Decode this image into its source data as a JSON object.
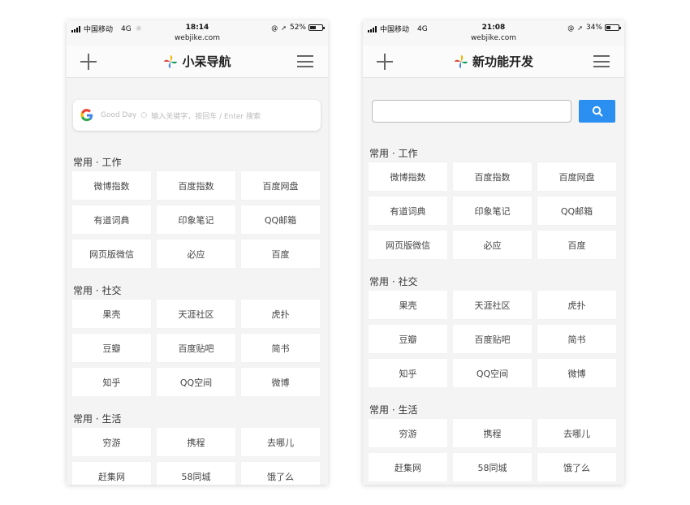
{
  "left_screen": {
    "status": {
      "carrier": "中国移动",
      "network": "4G",
      "loading": "☼",
      "time": "18:14",
      "url": "webjike.com",
      "battery": "52%",
      "battery_level": 0.52
    },
    "title": "小呆导航",
    "search": {
      "greeting": "Good Day",
      "separator": "○",
      "hint": "输入关键字，按回车 / Enter 搜索"
    },
    "sections": [
      {
        "title": "常用 · 工作",
        "items": [
          "微博指数",
          "百度指数",
          "百度网盘",
          "有道词典",
          "印象笔记",
          "QQ邮箱",
          "网页版微信",
          "必应",
          "百度"
        ]
      },
      {
        "title": "常用 · 社交",
        "items": [
          "果壳",
          "天涯社区",
          "虎扑",
          "豆瓣",
          "百度贴吧",
          "简书",
          "知乎",
          "QQ空间",
          "微博"
        ]
      },
      {
        "title": "常用 · 生活",
        "items": [
          "穷游",
          "携程",
          "去哪儿",
          "赶集网",
          "58同城",
          "饿了么"
        ]
      }
    ]
  },
  "right_screen": {
    "status": {
      "carrier": "中国移动",
      "network": "4G",
      "time": "21:08",
      "url": "webjike.com",
      "battery": "34%",
      "battery_level": 0.34
    },
    "title": "新功能开发",
    "search": {
      "value": ""
    },
    "sections": [
      {
        "title": "常用 · 工作",
        "items": [
          "微博指数",
          "百度指数",
          "百度网盘",
          "有道词典",
          "印象笔记",
          "QQ邮箱",
          "网页版微信",
          "必应",
          "百度"
        ]
      },
      {
        "title": "常用 · 社交",
        "items": [
          "果壳",
          "天涯社区",
          "虎扑",
          "豆瓣",
          "百度贴吧",
          "简书",
          "知乎",
          "QQ空间",
          "微博"
        ]
      },
      {
        "title": "常用 · 生活",
        "items": [
          "穷游",
          "携程",
          "去哪儿",
          "赶集网",
          "58同城",
          "饿了么"
        ]
      }
    ]
  },
  "colors": {
    "accent": "#2b8ff2",
    "background": "#f4f4f4"
  },
  "icons": {
    "add": "plus-icon",
    "menu": "hamburger-menu-icon",
    "logo": "pinwheel-logo-icon",
    "google": "google-g-icon",
    "search": "magnifier-icon"
  }
}
